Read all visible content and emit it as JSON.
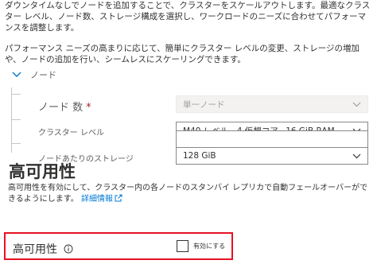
{
  "intro": {
    "paragraph1": "ダウンタイムなしでノードを追加することで、クラスターをスケールアウトします。最適なクラスター レベル、ノード数、ストレージ構成を選択し、ワークロードのニーズに合わせてパフォーマンスを調整します。",
    "paragraph2": "パフォーマンス ニーズの高まりに応じて、簡単にクラスター レベルの変更、ストレージの増加や、ノードの追加を行い、シームレスにスケーリングできます。"
  },
  "nodes_section": {
    "title": "ノード",
    "expanded": true,
    "node_count": {
      "label": "ノード 数",
      "required_mark": "*",
      "value": "単一ノード",
      "disabled": true
    },
    "cluster_tier": {
      "label": "クラスター レベル",
      "value": "M40 レベル、4 仮想コア、16 GiB RAM"
    },
    "storage_per_node": {
      "label": "ノードあたりのストレージ",
      "value": "128 GiB"
    }
  },
  "high_availability": {
    "heading": "高可用性",
    "description": "高可用性を有効にして、クラスター内の各ノードのスタンバイ レプリカで自動フェールオーバーができるようにします。",
    "link_text": "詳細情報",
    "field_label": "高可用性",
    "checkbox_label": "有効にする",
    "checked": false
  },
  "colors": {
    "highlight_border": "#e81123",
    "link": "#0078d4",
    "required": "#a4262c"
  }
}
